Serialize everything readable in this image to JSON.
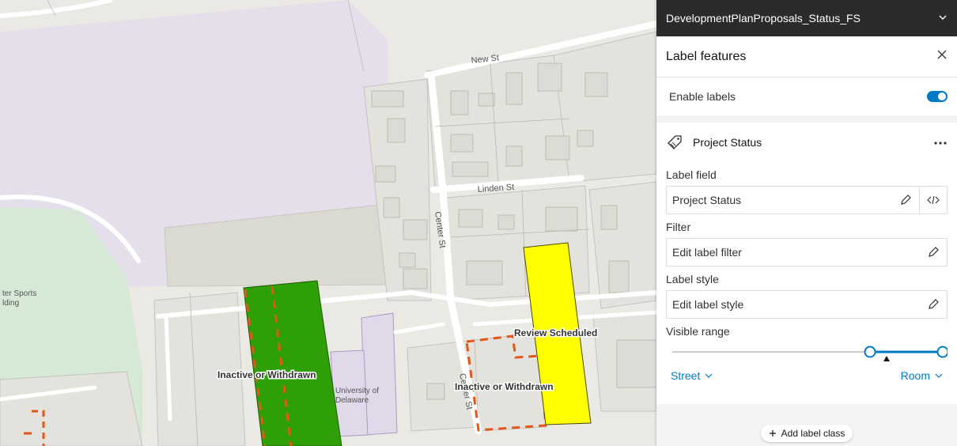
{
  "map": {
    "streets": {
      "new": "New St",
      "linden": "Linden St",
      "center_upper": "Center St",
      "center_lower": "Center St"
    },
    "places": {
      "sports_line1": "ter Sports",
      "sports_line2": "lding",
      "university_line1": "University of",
      "university_line2": "Delaware"
    },
    "features": {
      "inactive_left": "Inactive or Withdrawn",
      "review": "Review Scheduled",
      "inactive_right": "Inactive or Withdrawn"
    },
    "colors": {
      "green": "#2e9f06",
      "yellow": "#ffff00",
      "dash": "#e2571a"
    }
  },
  "panel": {
    "layer_name": "DevelopmentPlanProposals_Status_FS",
    "title": "Label features",
    "enable_labels": "Enable labels",
    "enabled": true,
    "label_class": {
      "name": "Project Status",
      "label_field_title": "Label field",
      "label_field_value": "Project Status",
      "filter_title": "Filter",
      "filter_value": "Edit label filter",
      "style_title": "Label style",
      "style_value": "Edit label style",
      "range_title": "Visible range",
      "range_min": "Street",
      "range_max": "Room"
    },
    "add_label_class": "Add label class",
    "accent": "#007ac2"
  }
}
